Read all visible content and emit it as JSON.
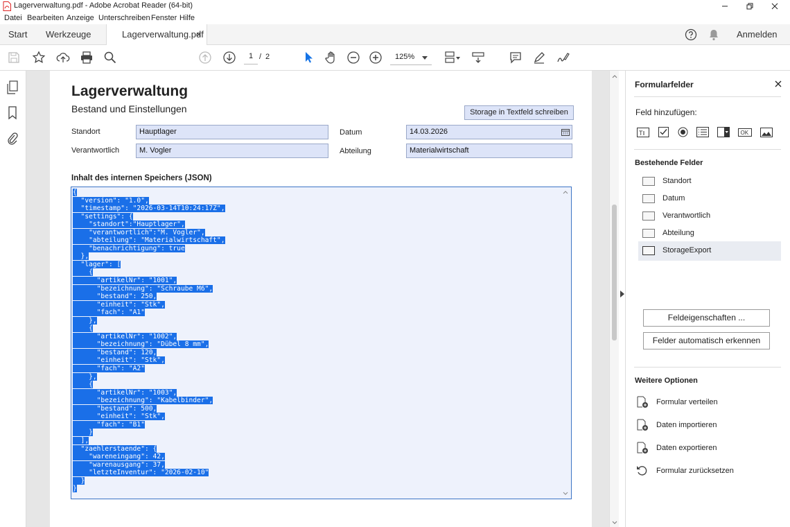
{
  "window": {
    "title": "Lagerverwaltung.pdf - Adobe Acrobat Reader (64-bit)"
  },
  "menu": [
    "Datei",
    "Bearbeiten",
    "Anzeige",
    "Unterschreiben",
    "Fenster",
    "Hilfe"
  ],
  "tabs": {
    "start": "Start",
    "tools": "Werkzeuge",
    "document": "Lagerverwaltung.pdf",
    "close_glyph": "×",
    "signin": "Anmelden"
  },
  "toolbar": {
    "page_current": "1",
    "page_separator": "/",
    "page_total": "2",
    "zoom": "125%"
  },
  "form": {
    "heading": "Lagerverwaltung",
    "subheading": "Bestand und Einstellungen",
    "store_button": "Storage in Textfeld schreiben",
    "fields": {
      "standort_label": "Standort",
      "standort_value": "Hauptlager",
      "verantwortlich_label": "Verantwortlich",
      "verantwortlich_value": "M. Vogler",
      "datum_label": "Datum",
      "datum_value": "14.03.2026",
      "abteilung_label": "Abteilung",
      "abteilung_value": "Materialwirtschaft"
    },
    "json_section_title": "Inhalt des internen Speichers (JSON)",
    "json_lines": [
      "{",
      "  \"version\": \"1.0\",",
      "  \"timestamp\": \"2026-03-14T10:24:17Z\",",
      "  \"settings\": {",
      "    \"standort\":\"Hauptlager\",",
      "    \"verantwortlich\":\"M. Vogler\",",
      "    \"abteilung\": \"Materialwirtschaft\",",
      "    \"benachrichtigung\": true",
      "  },",
      "  \"lager\": [",
      "    {",
      "      \"artikelNr\": \"1001\",",
      "      \"bezeichnung\": \"Schraube M6\",",
      "      \"bestand\": 250,",
      "      \"einheit\": \"Stk\",",
      "      \"fach\": \"A1\"",
      "    },",
      "    {",
      "      \"artikelNr\": \"1002\",",
      "      \"bezeichnung\": \"Dübel 8 mm\",",
      "      \"bestand\": 120,",
      "      \"einheit\": \"Stk\",",
      "      \"fach\": \"A2\"",
      "    },",
      "    {",
      "      \"artikelNr\": \"1003\",",
      "      \"bezeichnung\": \"Kabelbinder\",",
      "      \"bestand\": 500,",
      "      \"einheit\": \"Stk\",",
      "      \"fach\": \"B1\"",
      "    }",
      "  ],",
      "  \"zaehlerstaende\": {",
      "    \"wareneingang\": 42,",
      "    \"warenausgang\": 37,",
      "    \"letzteInventur\": \"2026-02-10\"",
      "  }",
      "}"
    ]
  },
  "right_panel": {
    "title": "Formularfelder",
    "add_field_label": "Feld hinzufügen:",
    "existing_fields_heading": "Bestehende Felder",
    "existing_fields": [
      "Standort",
      "Datum",
      "Verantwortlich",
      "Abteilung",
      "StorageExport"
    ],
    "selected_field": "StorageExport",
    "properties_button": "Feldeigenschaften ...",
    "autodetect_button": "Felder automatisch erkennen",
    "more_options_heading": "Weitere Optionen",
    "options": [
      "Formular verteilen",
      "Daten importieren",
      "Daten exportieren",
      "Formular zurücksetzen"
    ]
  },
  "colors": {
    "selection": "#1a6fe8",
    "field_fill": "#dde4f8",
    "accent_blue": "#1473e6"
  }
}
